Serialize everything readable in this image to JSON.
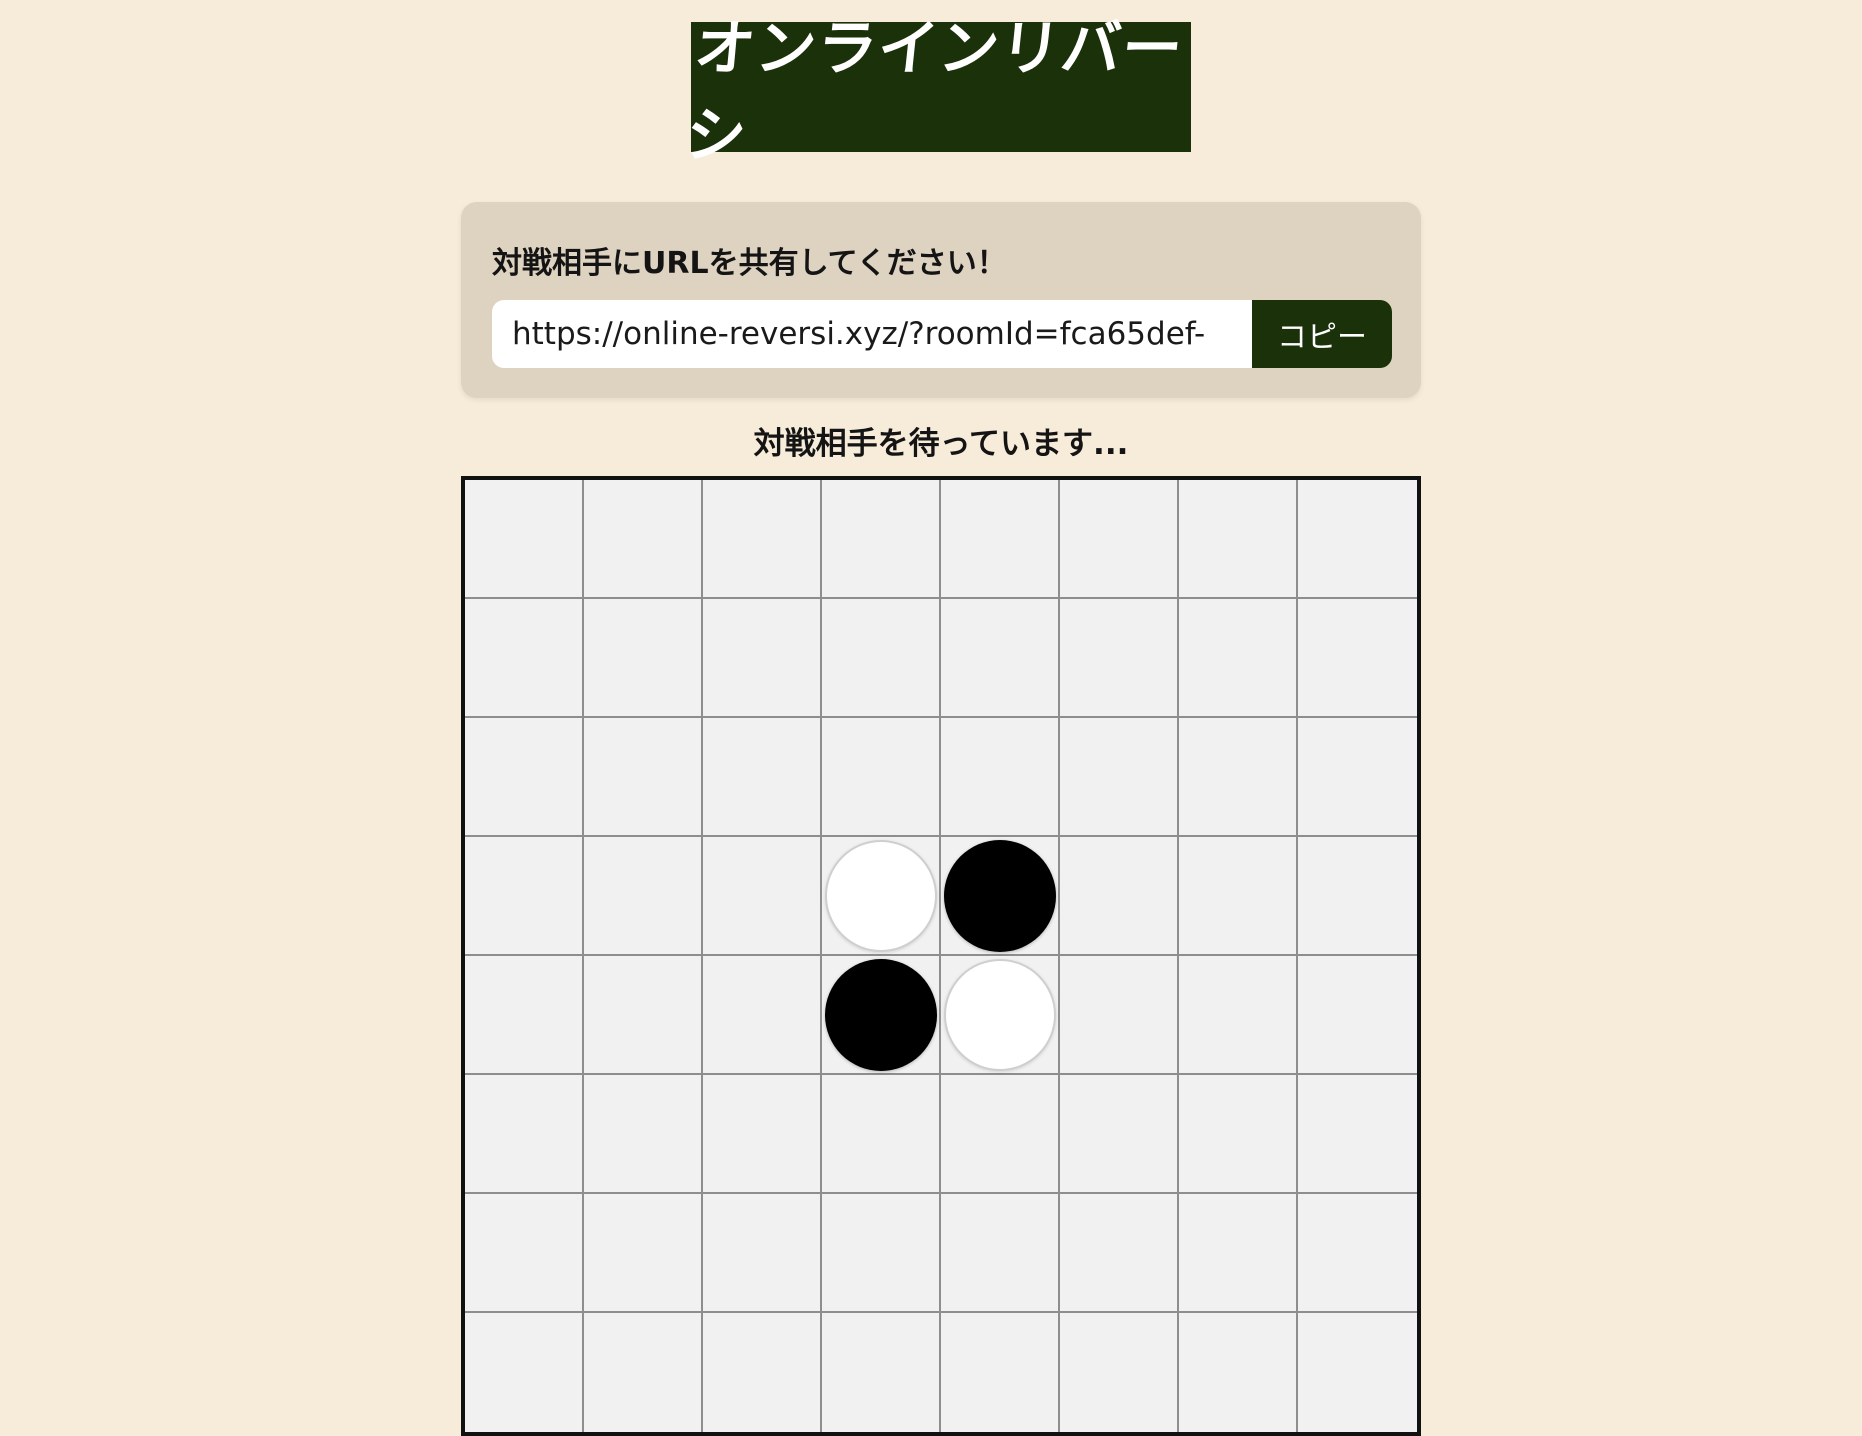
{
  "header": {
    "logo_text": "オンラインリバーシ"
  },
  "share": {
    "title": "対戦相手にURLを共有してください！",
    "url_value": "https://online-reversi.xyz/?roomId=fca65def-",
    "copy_label": "コピー"
  },
  "status": {
    "text": "対戦相手を待っています..."
  },
  "board": {
    "size": 8,
    "discs": [
      {
        "row": 3,
        "col": 3,
        "color": "white"
      },
      {
        "row": 3,
        "col": 4,
        "color": "black"
      },
      {
        "row": 4,
        "col": 3,
        "color": "black"
      },
      {
        "row": 4,
        "col": 4,
        "color": "white"
      }
    ]
  },
  "colors": {
    "background": "#f7ecda",
    "brand": "#1b310a",
    "panel": "#ded2c1",
    "board": "#f1f1f1"
  }
}
